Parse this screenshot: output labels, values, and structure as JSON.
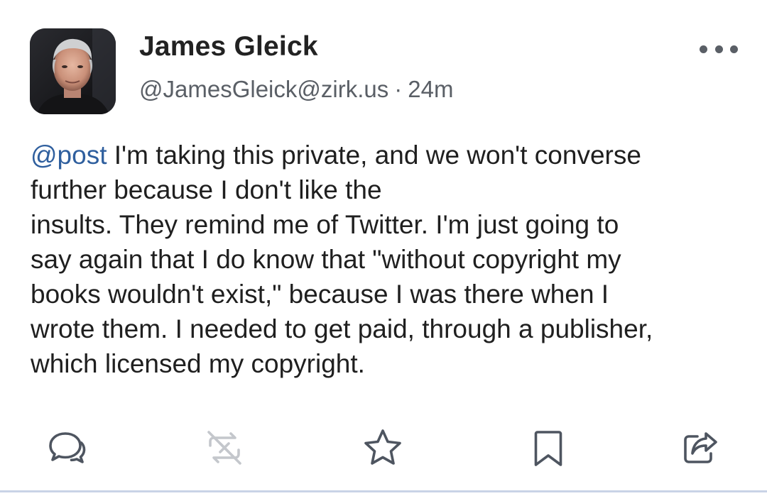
{
  "post": {
    "author": {
      "display_name": "James Gleick",
      "handle": "@JamesGleick@zirk.us",
      "avatar_icon": "author-avatar-photo"
    },
    "separator": "·",
    "timestamp": "24m",
    "content": {
      "mention": "@post",
      "lines": [
        " I'm taking this private, and we won't converse",
        "further because I don't like the",
        "insults. They remind me of Twitter. I'm just going to",
        "say again that I do know that \"without copyright my",
        "books wouldn't exist,\" because I was there when I",
        "wrote them. I needed to get paid, through a publisher,",
        "which licensed my copyright."
      ]
    },
    "actions": {
      "reply_icon": "reply-icon",
      "boost_icon": "boost-disabled-icon",
      "favourite_icon": "star-icon",
      "bookmark_icon": "bookmark-icon",
      "share_icon": "share-icon",
      "more_icon": "more-dots-icon"
    }
  },
  "colors": {
    "mention": "#2f5f9e",
    "text": "#1f1f1f",
    "meta": "#5a5f66",
    "icon": "#4e5560",
    "icon_disabled": "#c4c7cc",
    "divider": "#c9d3e6"
  }
}
